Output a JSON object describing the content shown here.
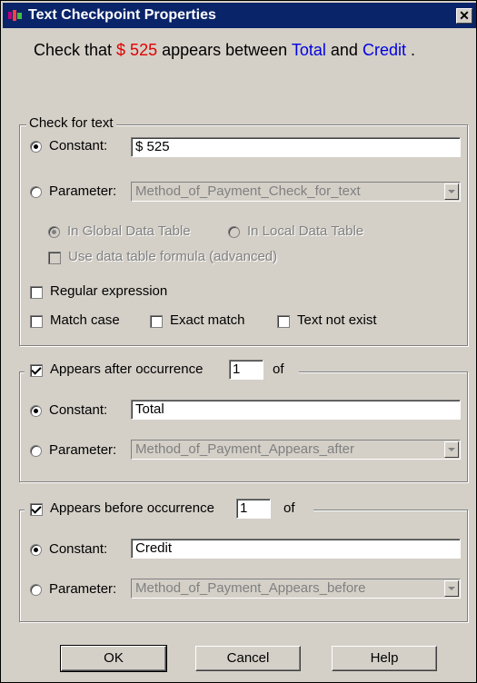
{
  "window": {
    "title": "Text Checkpoint Properties",
    "close_glyph": "✕"
  },
  "summary": {
    "prefix": "Check that ",
    "value": "$ 525",
    "middle": " appears between ",
    "after": "Total",
    "and": " and ",
    "before": "Credit",
    "end": " ."
  },
  "check_for_text": {
    "legend": "Check for text",
    "constant_label": "Constant:",
    "constant_value": "$ 525",
    "parameter_label": "Parameter:",
    "parameter_value": "Method_of_Payment_Check_for_text",
    "global_label": "In Global Data Table",
    "local_label": "In Local Data Table",
    "formula_label": "Use data table formula (advanced)",
    "regex_label": "Regular expression",
    "match_case_label": "Match case",
    "exact_match_label": "Exact match",
    "text_not_exist_label": "Text not exist"
  },
  "appears_after": {
    "label": "Appears after occurrence",
    "occurrence": "1",
    "of": "of",
    "constant_label": "Constant:",
    "constant_value": "Total",
    "parameter_label": "Parameter:",
    "parameter_value": "Method_of_Payment_Appears_after"
  },
  "appears_before": {
    "label": "Appears before occurrence",
    "occurrence": "1",
    "of": "of",
    "constant_label": "Constant:",
    "constant_value": "Credit",
    "parameter_label": "Parameter:",
    "parameter_value": "Method_of_Payment_Appears_before"
  },
  "buttons": {
    "ok": "OK",
    "cancel": "Cancel",
    "help": "Help"
  },
  "colors": {
    "title_bar": "#0a246a",
    "value_highlight": "#e00000",
    "anchor_highlight": "#0000e0",
    "dialog_bg": "#d4d0c8"
  }
}
